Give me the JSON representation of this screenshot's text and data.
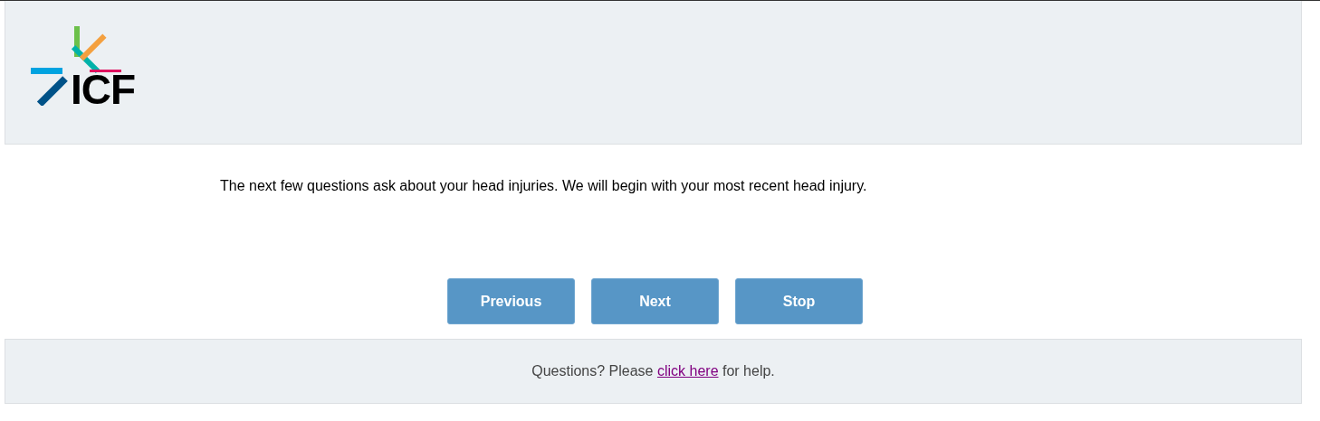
{
  "header": {
    "logo_text": "ICF"
  },
  "question": {
    "text": "The next few questions ask about your head injuries. We will begin with your most recent head injury."
  },
  "buttons": [
    {
      "label": "Previous"
    },
    {
      "label": "Next"
    },
    {
      "label": "Stop"
    }
  ],
  "footer": {
    "before": "Questions? Please ",
    "link": "click here",
    "after": " for help."
  }
}
